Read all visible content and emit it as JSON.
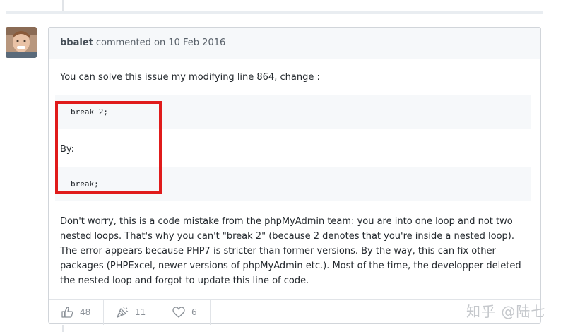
{
  "comment": {
    "author": "bbalet",
    "meta": "commented on 10 Feb 2016",
    "intro": "You can solve this issue my modifying line 864, change :",
    "code_before": "break 2;",
    "connector": "By:",
    "code_after": "break;",
    "explanation": "Don't worry, this is a code mistake from the phpMyAdmin team: you are into one loop and not two nested loops. That's why you can't \"break 2\" (because 2 denotes that you're inside a nested loop). The error appears because PHP7 is stricter than former versions. By the way, this can fix other packages (PHPExcel, newer versions of phpMyAdmin etc.). Most of the time, the developper deleted the nested loop and forgot to update this line of code."
  },
  "reactions": [
    {
      "icon": "thumbs-up-icon",
      "count": "48"
    },
    {
      "icon": "party-popper-icon",
      "count": "11"
    },
    {
      "icon": "heart-icon",
      "count": "6"
    }
  ],
  "watermark": "知乎 @陆七",
  "colors": {
    "highlight": "#e01b1b",
    "code_bg": "#f6f8fa",
    "border": "#d1d5da"
  }
}
